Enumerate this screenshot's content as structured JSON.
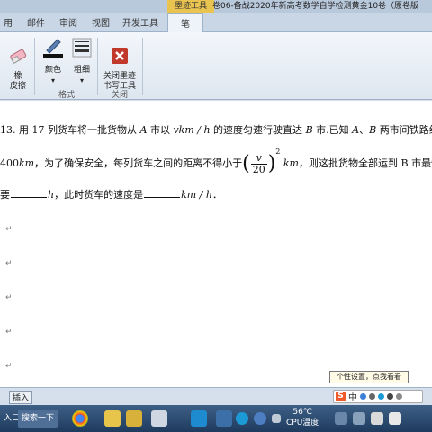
{
  "titlebar": {
    "context_tab": "墨迹工具",
    "doc_title": "卷06-备战2020年新高考数学自学检测黄金10卷（原卷版"
  },
  "tabs": [
    {
      "label": "用"
    },
    {
      "label": "邮件"
    },
    {
      "label": "审阅"
    },
    {
      "label": "视图"
    },
    {
      "label": "开发工具"
    },
    {
      "label": "笔"
    }
  ],
  "ribbon": {
    "eraser_label": "橡\n皮擦",
    "color_label": "颜色",
    "thickness_label": "粗细",
    "format_group": "格式",
    "close_label": "关闭墨迹\n书写工具",
    "close_group": "关闭",
    "dropdown_glyph": "▾"
  },
  "problem": {
    "line1": {
      "num": "13.",
      "t1": "用 17 列货车将一批货物从 ",
      "A": "A",
      "t2": " 市以 ",
      "v": "vkm / h",
      "t3": " 的速度匀速行驶直达 ",
      "B": "B",
      "t4": " 市.已知 ",
      "A2": "A",
      "t5": "、",
      "B2": "B",
      "t6": " 两市间铁路线长"
    },
    "line2": {
      "dist": "400",
      "km": "km",
      "t1": "，为了确保安全，每列货车之间的距离不得小于",
      "frac_num": "v",
      "frac_den": "20",
      "exp": "2",
      "km2": "km",
      "t2": "，则这批货物全部运到 B 市最快需"
    },
    "line3": {
      "t1": "要",
      "h": "h",
      "t2": "，此时货车的速度是",
      "unit": "km / h",
      "t3": "．"
    }
  },
  "para_mark": "↵",
  "tooltip": "个性设置，点我看看",
  "status": {
    "insert": "插入",
    "ime_zh": "中"
  },
  "taskbar": {
    "start_partial": "入口",
    "search": "搜索一下",
    "temperature": "56℃",
    "cpu": "CPU温度"
  },
  "colors": {
    "ribbon_bg": "#e6edf5",
    "context_tab": "#e9c451",
    "taskbar": "#2a4a70",
    "close_icon": "#c0392b"
  }
}
